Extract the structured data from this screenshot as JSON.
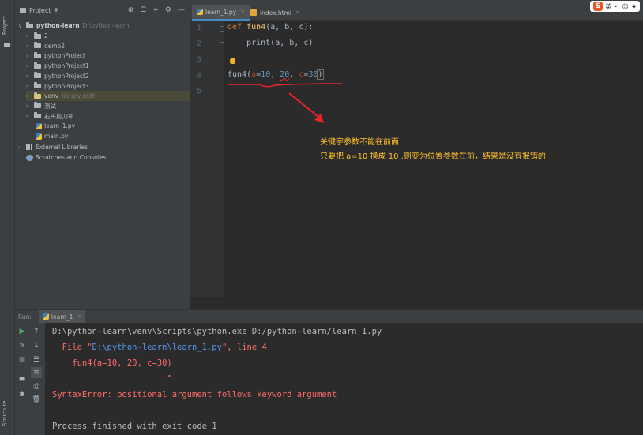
{
  "left_strip": {
    "project_tab": "Project",
    "structure_tab": "Structure"
  },
  "project_panel": {
    "title": "Project",
    "root": {
      "name": "python-learn",
      "path": "D:\\python-learn"
    },
    "items": [
      {
        "label": "2",
        "type": "folder"
      },
      {
        "label": "demo2",
        "type": "folder"
      },
      {
        "label": "pythonProject",
        "type": "folder"
      },
      {
        "label": "pythonProject1",
        "type": "folder"
      },
      {
        "label": "pythonProject2",
        "type": "folder"
      },
      {
        "label": "pythonProject3",
        "type": "folder"
      },
      {
        "label": "venv",
        "type": "folder",
        "note": "library root"
      },
      {
        "label": "测试",
        "type": "folder"
      },
      {
        "label": "石头剪刀布",
        "type": "folder"
      },
      {
        "label": "learn_1.py",
        "type": "python"
      },
      {
        "label": "main.py",
        "type": "python"
      }
    ],
    "external_libraries": "External Libraries",
    "scratches": "Scratches and Consoles"
  },
  "editor": {
    "tabs": [
      {
        "label": "learn_1.py",
        "active": true
      },
      {
        "label": "index.html",
        "active": false
      }
    ],
    "line_numbers": [
      "1",
      "2",
      "3",
      "4",
      "5"
    ],
    "code": {
      "line1_kw": "def ",
      "line1_fn": "fun4",
      "line1_rest": "(a, b, c):",
      "line2": "    print(a, b, c)",
      "line4_fn": "fun4(",
      "line4_a": "a",
      "line4_eq1": "=",
      "line4_10": "10",
      "line4_comma1": ", ",
      "line4_20": "20",
      "line4_comma2": ", ",
      "line4_c": "c",
      "line4_eq2": "=",
      "line4_30": "30",
      "line4_close": ")"
    }
  },
  "annotation": {
    "line1": "关键字参数不能在前面",
    "line2": "只要把 a=10 换成 10 ,则变为位置参数在前，结果是没有报错的",
    "color": "#ffc125"
  },
  "ime_indicator": {
    "logo": "S",
    "lang": "英"
  },
  "run_panel": {
    "label": "Run:",
    "tab": "learn_1",
    "console": {
      "cmd": "D:\\python-learn\\venv\\Scripts\\python.exe D:/python-learn/learn_1.py",
      "file_prefix": "  File \"",
      "file_link": "D:\\python-learn\\learn_1.py",
      "file_suffix": "\", line 4",
      "code_line": "    fun4(a=10, 20, c=30)",
      "caret": "                       ^",
      "error": "SyntaxError: positional argument follows keyword argument",
      "finished": "Process finished with exit code 1"
    }
  },
  "colors": {
    "error": "#ff6b68",
    "keyword": "#cc7832",
    "function": "#ffc66d",
    "number": "#6897bb",
    "param": "#aa4926",
    "annotation_red": "#e8242a"
  }
}
